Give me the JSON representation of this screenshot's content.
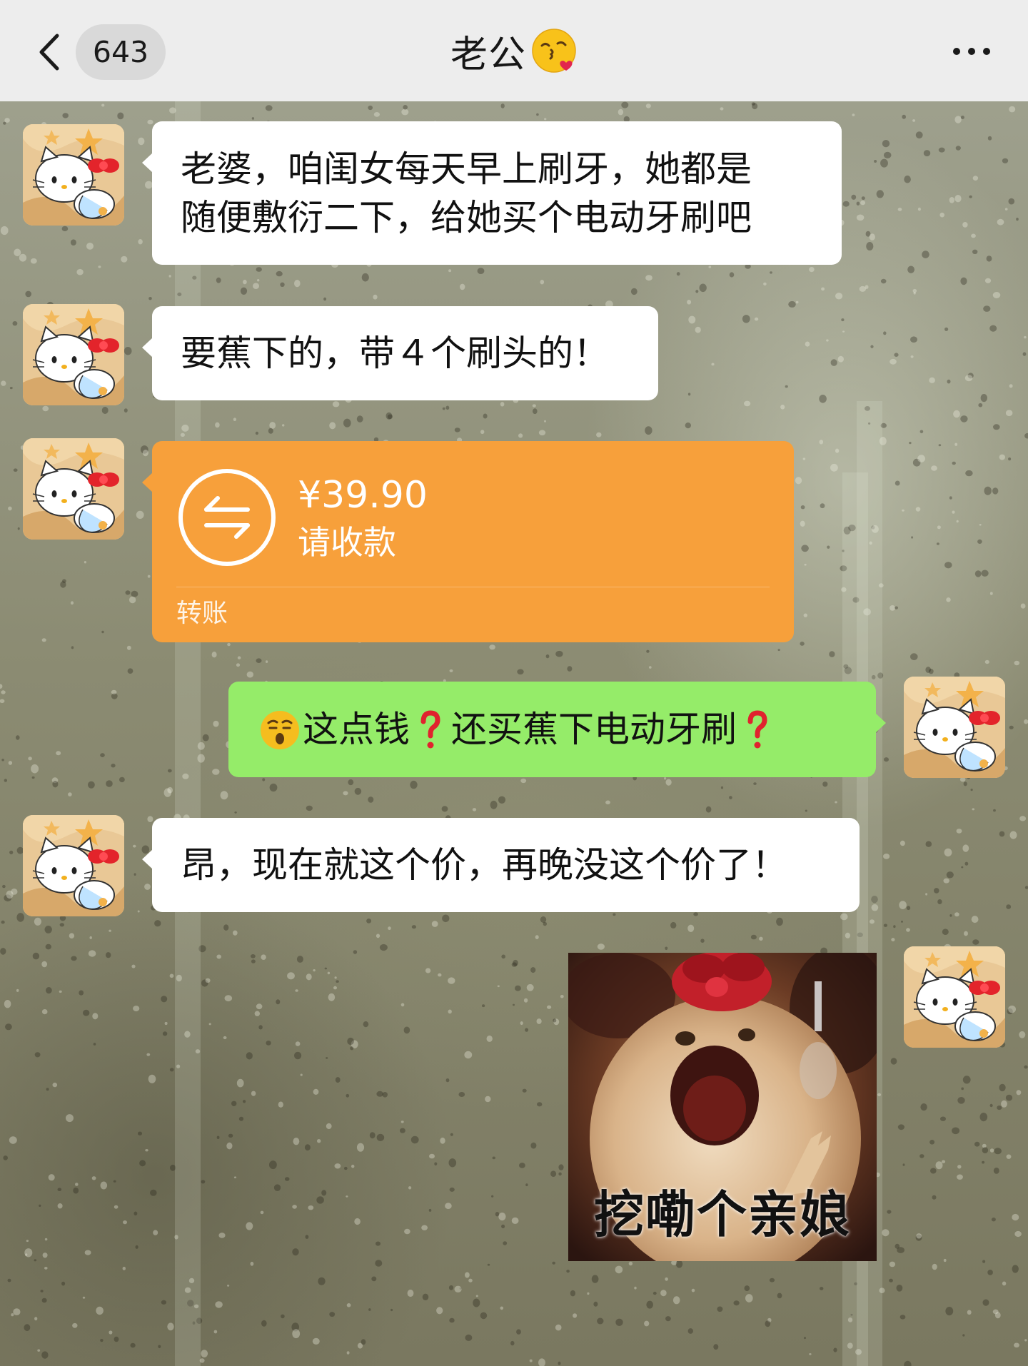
{
  "header": {
    "back_icon": "chevron-left-icon",
    "unread_count": "643",
    "title": "老公",
    "title_emoji": "face-blowing-kiss-icon",
    "more_icon": "more-dots-icon",
    "background": "#ededed"
  },
  "colors": {
    "incoming_bubble": "#ffffff",
    "outgoing_bubble": "#95ec69",
    "transfer_card": "#f7a03b"
  },
  "messages": [
    {
      "side": "left",
      "text": "老婆，咱闺女每天早上刷牙，她都是\n随便敷衍二下，给她买个电动牙刷吧"
    },
    {
      "side": "left",
      "text": "要蕉下的，带４个刷头的！"
    },
    {
      "side": "left",
      "type": "transfer",
      "amount": "¥39.90",
      "status": "请收款",
      "label": "转账",
      "icon": "transfer-arrows-icon"
    },
    {
      "side": "right",
      "emoji": "skeptical-face-icon",
      "part1": "这点钱",
      "q_icon": "red-question-mark-icon",
      "part2": "还买蕉下电动牙刷"
    },
    {
      "side": "left",
      "text": "昂，现在就这个价，再晚没这个价了！"
    },
    {
      "side": "right",
      "type": "sticker",
      "caption": "挖嘞个亲娘"
    }
  ]
}
